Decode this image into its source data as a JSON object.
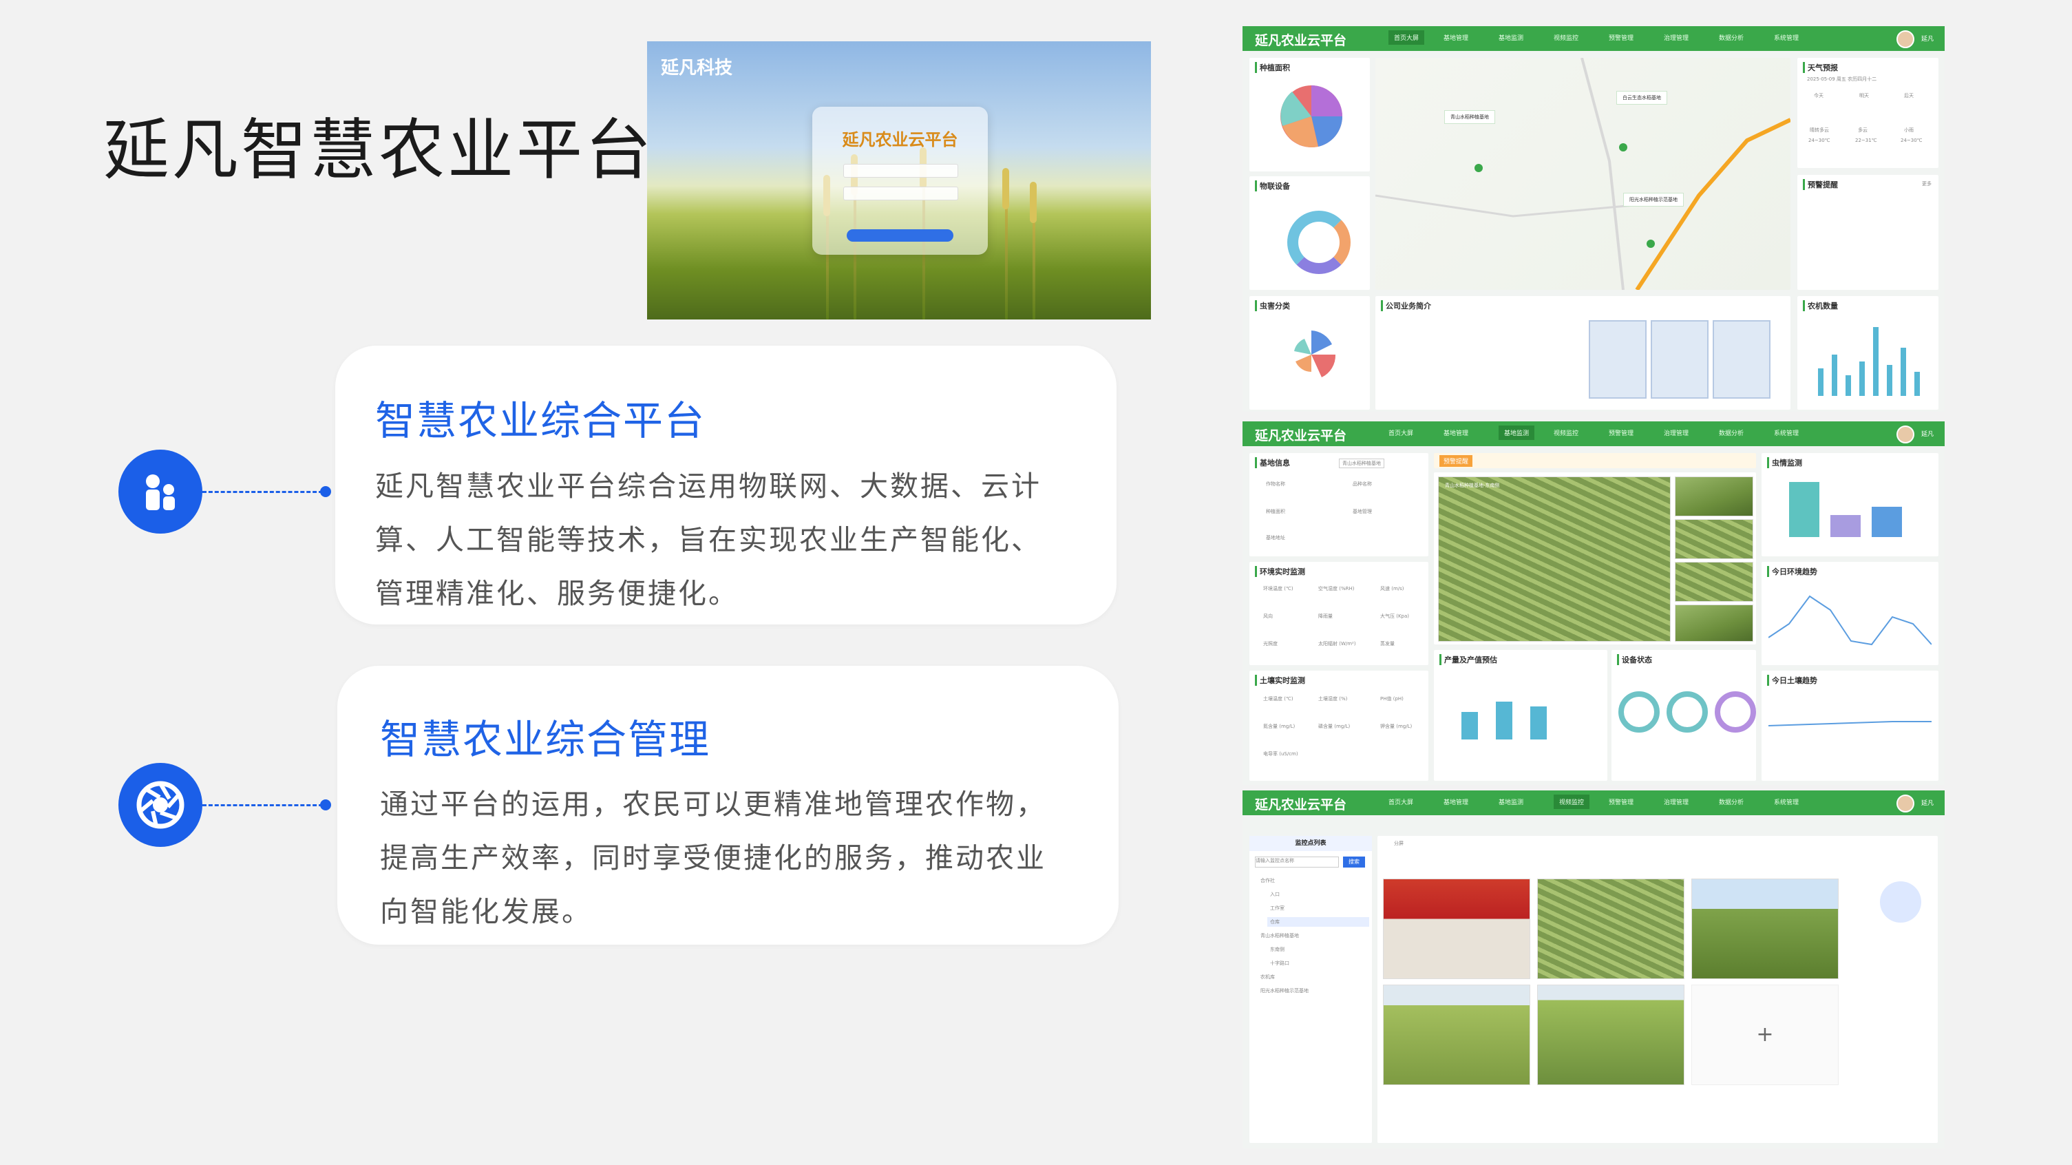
{
  "page": {
    "title": "延凡智慧农业平台"
  },
  "hero": {
    "logo_text": "延凡科技",
    "login_title": "延凡农业云平台"
  },
  "cards": [
    {
      "heading": "智慧农业综合平台",
      "lines": [
        "延凡智慧农业平台综合运用物联网、大数据、云计",
        "算、人工智能等技术，旨在实现农业生产智能化、",
        "管理精准化、服务便捷化。"
      ]
    },
    {
      "heading": "智慧农业综合管理",
      "lines": [
        "通过平台的运用，农民可以更精准地管理农作物，",
        "提高生产效率，同时享受便捷化的服务，推动农业",
        "向智能化发展。"
      ]
    }
  ],
  "icons": {
    "card1": "people-icon",
    "card2": "aperture-icon"
  },
  "colors": {
    "accent": "#1b5fe8",
    "brand_green": "#3aa84a"
  },
  "dashboard": {
    "brand": "延凡农业云平台",
    "nav": [
      "首页大屏",
      "基地管理",
      "基地监测",
      "视频监控",
      "预警管理",
      "治理管理",
      "数据分析",
      "系统管理"
    ],
    "user": "延凡",
    "screen1": {
      "panels": [
        "种植面积",
        "物联设备",
        "虫害分类",
        "公司业务简介",
        "天气预报",
        "预警提醒",
        "农机数量"
      ],
      "map_labels": [
        "青山水稻种植基地",
        "白云生态水稻基地",
        "阳光水稻种植示范基地"
      ],
      "weather_date": "2025-05-09  周五  农历四月十二",
      "weather_days": [
        "今天",
        "明天",
        "后天"
      ],
      "weather_desc": [
        "晴转多云",
        "多云",
        "小雨"
      ],
      "weather_temp": [
        "24~30℃",
        "22~31℃",
        "24~30℃"
      ],
      "alert_more": "更多"
    },
    "screen2": {
      "panels": [
        "基地信息",
        "环境实时监测",
        "土壤实时监测",
        "预警提醒",
        "青山水稻种植基地-东南侧",
        "产量及产值预估",
        "设备状态",
        "虫情监测",
        "今日环境趋势",
        "今日土壤趋势"
      ],
      "base_select": "青山水稻种植基地",
      "base_fields": [
        "作物名称",
        "品种名称",
        "种植面积",
        "基地管理",
        "基地地址"
      ],
      "env_fields": [
        "环境温度 (℃)",
        "空气湿度 (%RH)",
        "风速 (m/s)",
        "风向",
        "降雨量",
        "大气压 (Kpa)",
        "光照度",
        "太阳辐射 (W/m²)",
        "蒸发量"
      ],
      "soil_fields": [
        "土壤温度 (℃)",
        "土壤湿度 (%)",
        "PH值 (pH)",
        "氮含量 (mg/L)",
        "磷含量 (mg/L)",
        "钾含量 (mg/L)",
        "电导率 (uS/cm)"
      ]
    },
    "screen3": {
      "panels": [
        "监控点列表",
        "分屏"
      ],
      "search_placeholder": "请输入监控点名称",
      "search_btn": "搜索",
      "tree": [
        "合作社",
        "入口",
        "工作室",
        "仓库",
        "青山水稻种植基地",
        "东南侧",
        "十字路口",
        "农机库",
        "阳光水稻种植示范基地"
      ],
      "add_symbol": "+"
    }
  }
}
